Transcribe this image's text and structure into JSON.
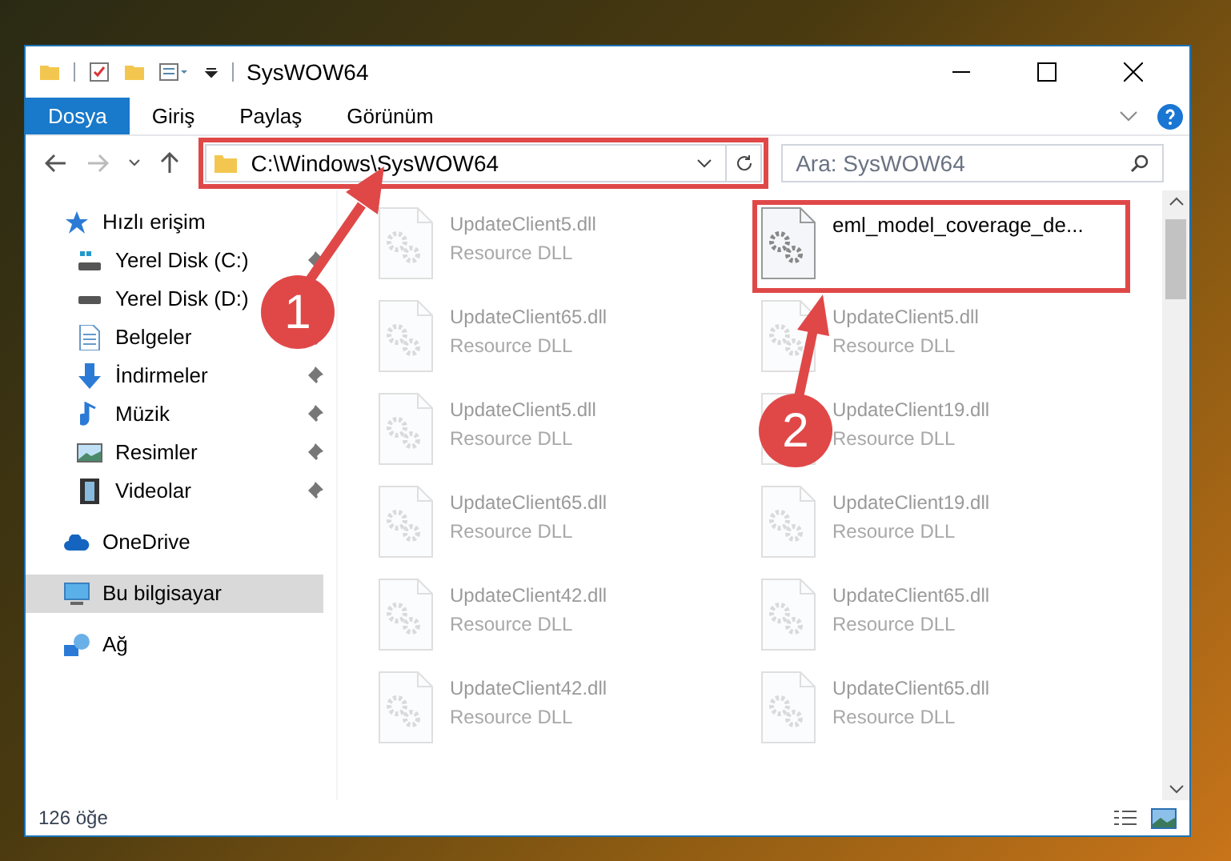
{
  "window": {
    "title": "SysWOW64"
  },
  "ribbon_tabs": [
    {
      "label": "Dosya",
      "selected": true
    },
    {
      "label": "Giriş",
      "selected": false
    },
    {
      "label": "Paylaş",
      "selected": false
    },
    {
      "label": "Görünüm",
      "selected": false
    }
  ],
  "address": {
    "path": "C:\\Windows\\SysWOW64",
    "highlighted": true
  },
  "search": {
    "placeholder": "Ara: SysWOW64"
  },
  "sidebar": [
    {
      "label": "Hızlı erişim",
      "kind": "star",
      "selected": false,
      "children": [
        {
          "label": "Yerel Disk (C:)",
          "kind": "drive-win",
          "pinned": true
        },
        {
          "label": "Yerel Disk (D:)",
          "kind": "drive"
        },
        {
          "label": "Belgeler",
          "kind": "document",
          "pinned": true
        },
        {
          "label": "İndirmeler",
          "kind": "download",
          "pinned": true
        },
        {
          "label": "Müzik",
          "kind": "music",
          "pinned": true
        },
        {
          "label": "Resimler",
          "kind": "picture",
          "pinned": true
        },
        {
          "label": "Videolar",
          "kind": "video",
          "pinned": true
        }
      ]
    },
    {
      "label": "OneDrive",
      "kind": "cloud",
      "selected": false
    },
    {
      "label": "Bu bilgisayar",
      "kind": "computer",
      "selected": true
    },
    {
      "label": "Ağ",
      "kind": "network",
      "selected": false
    }
  ],
  "files": [
    {
      "name": "UpdateClient5.dll",
      "type": "Resource DLL",
      "blurred": true,
      "highlighted": false
    },
    {
      "name": "eml_model_coverage_de...",
      "blurred": false,
      "highlighted": true
    },
    {
      "name": "UpdateClient65.dll",
      "type": "Resource DLL",
      "blurred": true,
      "highlighted": false
    },
    {
      "name": "UpdateClient5.dll",
      "type": "Resource DLL",
      "blurred": true,
      "highlighted": false
    },
    {
      "name": "UpdateClient5.dll",
      "type": "Resource DLL",
      "blurred": true,
      "highlighted": false
    },
    {
      "name": "UpdateClient19.dll",
      "type": "Resource DLL",
      "blurred": true,
      "highlighted": false
    },
    {
      "name": "UpdateClient65.dll",
      "type": "Resource DLL",
      "blurred": true,
      "highlighted": false
    },
    {
      "name": "UpdateClient19.dll",
      "type": "Resource DLL",
      "blurred": true,
      "highlighted": false
    },
    {
      "name": "UpdateClient42.dll",
      "type": "Resource DLL",
      "blurred": true,
      "highlighted": false
    },
    {
      "name": "UpdateClient65.dll",
      "type": "Resource DLL",
      "blurred": true,
      "highlighted": false
    },
    {
      "name": "UpdateClient42.dll",
      "type": "Resource DLL",
      "blurred": true,
      "highlighted": false
    },
    {
      "name": "UpdateClient65.dll",
      "type": "Resource DLL",
      "blurred": true,
      "highlighted": false
    }
  ],
  "status_bar": {
    "item_count": "126 öğe"
  },
  "annotations": [
    {
      "number": "1"
    },
    {
      "number": "2"
    }
  ]
}
